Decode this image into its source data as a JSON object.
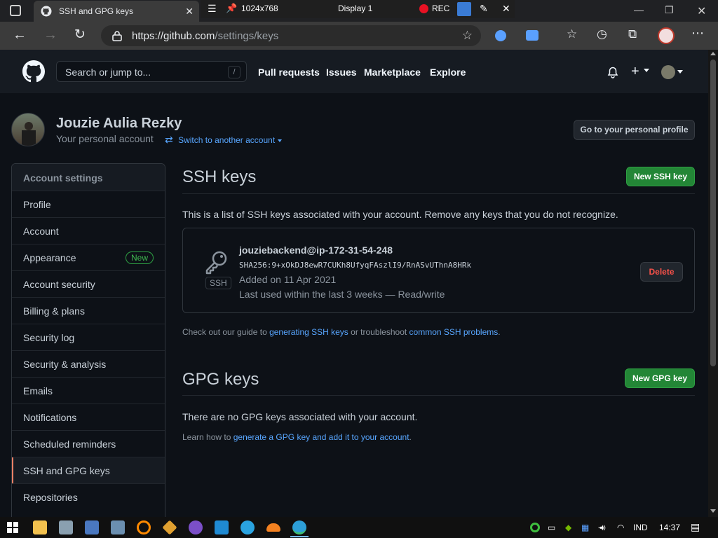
{
  "browser": {
    "tab_title": "SSH and GPG keys",
    "url_host": "https://github.com",
    "url_path": "/settings/keys",
    "recording": {
      "resolution": "1024x768",
      "display": "Display 1",
      "rec_label": "REC"
    }
  },
  "header": {
    "search_placeholder": "Search or jump to...",
    "search_shortcut": "/",
    "nav": [
      "Pull requests",
      "Issues",
      "Marketplace",
      "Explore"
    ]
  },
  "profile": {
    "name": "Jouzie Aulia Rezky",
    "subtitle": "Your personal account",
    "switch_label": "Switch to another account",
    "profile_button": "Go to your personal profile"
  },
  "sidebar": {
    "heading": "Account settings",
    "items": [
      {
        "label": "Profile"
      },
      {
        "label": "Account"
      },
      {
        "label": "Appearance",
        "badge": "New"
      },
      {
        "label": "Account security"
      },
      {
        "label": "Billing & plans"
      },
      {
        "label": "Security log"
      },
      {
        "label": "Security & analysis"
      },
      {
        "label": "Emails"
      },
      {
        "label": "Notifications"
      },
      {
        "label": "Scheduled reminders"
      },
      {
        "label": "SSH and GPG keys",
        "active": true
      },
      {
        "label": "Repositories"
      }
    ]
  },
  "ssh": {
    "title": "SSH keys",
    "new_button": "New SSH key",
    "description": "This is a list of SSH keys associated with your account. Remove any keys that you do not recognize.",
    "key": {
      "name": "jouziebackend@ip-172-31-54-248",
      "fingerprint": "SHA256:9+xOkDJ8ewR7CUKh8UfyqFAszlI9/RnASvUThnA8HRk",
      "added": "Added on 11 Apr 2021",
      "last_used": "Last used within the last 3 weeks — Read/write",
      "type_label": "SSH",
      "delete_label": "Delete"
    },
    "guide": {
      "prefix": "Check out our guide to ",
      "link1": "generating SSH keys",
      "middle": " or troubleshoot ",
      "link2": "common SSH problems",
      "suffix": "."
    }
  },
  "gpg": {
    "title": "GPG keys",
    "new_button": "New GPG key",
    "empty": "There are no GPG keys associated with your account.",
    "learn_prefix": "Learn how to ",
    "learn_link": "generate a GPG key and add it to your account",
    "learn_suffix": "."
  },
  "taskbar": {
    "language": "IND",
    "time": "14:37"
  },
  "colors": {
    "bg": "#0d1117",
    "header_bg": "#161b22",
    "link": "#58a6ff",
    "green_button": "#238636",
    "danger": "#f85149",
    "active_marker": "#f78166"
  }
}
